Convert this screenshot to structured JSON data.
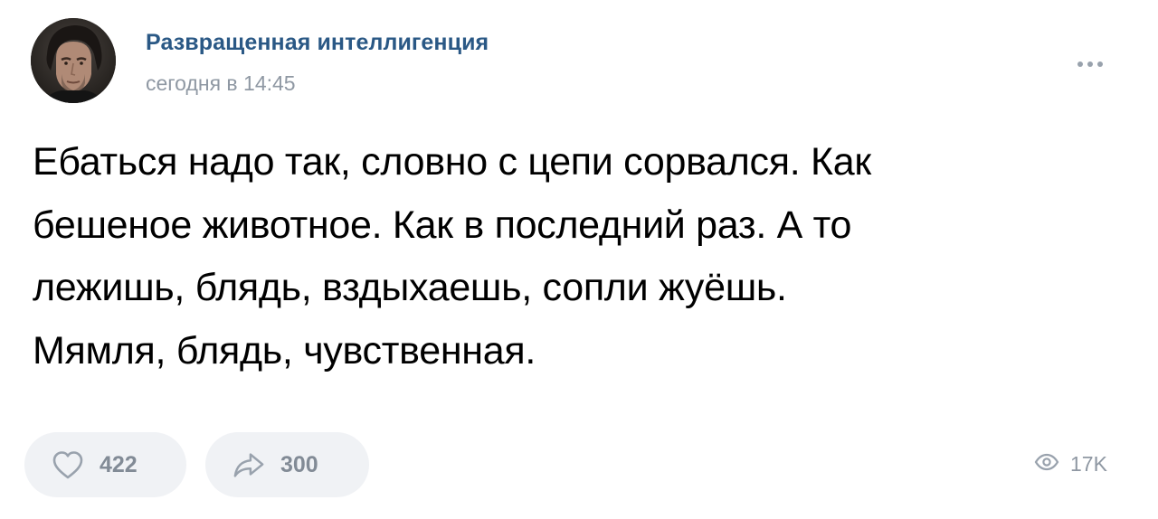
{
  "author": {
    "name": "Развращенная интеллигенция",
    "time": "сегодня в 14:45"
  },
  "post": {
    "lines": [
      "Ебаться надо так, словно с цепи сорвался. Как",
      "бешеное животное. Как в последний раз. А то",
      "лежишь, блядь, вздыхаешь, сопли жуёшь.",
      "Мямля, блядь, чувственная."
    ]
  },
  "actions": {
    "likes": "422",
    "shares": "300",
    "views": "17K"
  },
  "icons": {
    "like": "heart-icon",
    "share": "share-arrow-icon",
    "views": "eye-icon",
    "more": "more-dots-icon"
  },
  "colors": {
    "author": "#2a5885",
    "muted": "#8f98a3",
    "button_bg": "#f0f2f5",
    "icon": "#99a2ad"
  }
}
